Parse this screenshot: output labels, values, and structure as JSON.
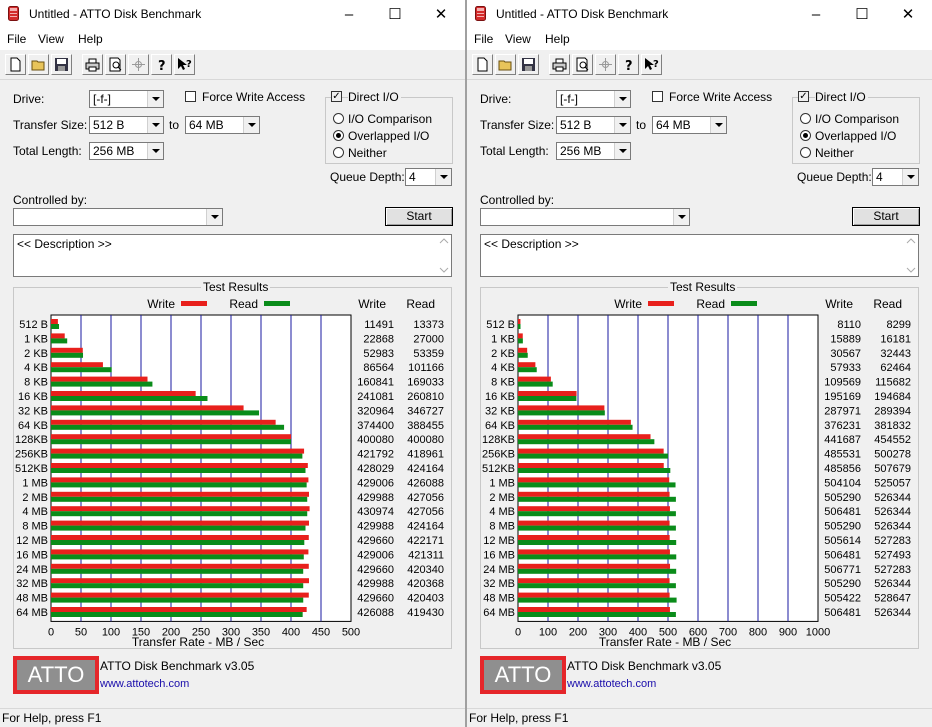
{
  "windows": [
    {
      "id": "left",
      "title": "Untitled - ATTO Disk Benchmark",
      "menu": [
        "File",
        "View",
        "Help"
      ],
      "drive_label": "Drive:",
      "drive_value": "[-f-]",
      "force_write_label": "Force Write Access",
      "force_write_checked": false,
      "direct_io_label": "Direct I/O",
      "direct_io_checked": true,
      "transfer_size_label": "Transfer Size:",
      "transfer_from": "512 B",
      "to_label": "to",
      "transfer_to": "64 MB",
      "total_length_label": "Total Length:",
      "total_length": "256 MB",
      "radio_io_comparison": "I/O Comparison",
      "radio_overlapped": "Overlapped I/O",
      "radio_neither": "Neither",
      "selected_mode": "Overlapped I/O",
      "queue_depth_label": "Queue Depth:",
      "queue_depth": "4",
      "controlled_by_label": "Controlled by:",
      "controlled_by_value": "",
      "start_label": "Start",
      "description": "<< Description >>",
      "results_title": "Test Results",
      "legend_write": "Write",
      "legend_read": "Read",
      "col_write": "Write",
      "col_read": "Read",
      "x_axis_label": "Transfer Rate - MB / Sec",
      "product": "ATTO Disk Benchmark v3.05",
      "url": "www.attotech.com",
      "logo_text": "ATTO",
      "status": "For Help, press F1"
    },
    {
      "id": "right",
      "title": "Untitled - ATTO Disk Benchmark",
      "menu": [
        "File",
        "View",
        "Help"
      ],
      "drive_label": "Drive:",
      "drive_value": "[-f-]",
      "force_write_label": "Force Write Access",
      "force_write_checked": false,
      "direct_io_label": "Direct I/O",
      "direct_io_checked": true,
      "transfer_size_label": "Transfer Size:",
      "transfer_from": "512 B",
      "to_label": "to",
      "transfer_to": "64 MB",
      "total_length_label": "Total Length:",
      "total_length": "256 MB",
      "radio_io_comparison": "I/O Comparison",
      "radio_overlapped": "Overlapped I/O",
      "radio_neither": "Neither",
      "selected_mode": "Overlapped I/O",
      "queue_depth_label": "Queue Depth:",
      "queue_depth": "4",
      "controlled_by_label": "Controlled by:",
      "controlled_by_value": "",
      "start_label": "Start",
      "description": "<< Description >>",
      "results_title": "Test Results",
      "legend_write": "Write",
      "legend_read": "Read",
      "col_write": "Write",
      "col_read": "Read",
      "x_axis_label": "Transfer Rate - MB / Sec",
      "product": "ATTO Disk Benchmark v3.05",
      "url": "www.attotech.com",
      "logo_text": "ATTO",
      "status": "For Help, press F1"
    }
  ],
  "chart_data": [
    {
      "type": "bar",
      "orientation": "horizontal",
      "categories": [
        "512 B",
        "1 KB",
        "2 KB",
        "4 KB",
        "8 KB",
        "16 KB",
        "32 KB",
        "64 KB",
        "128KB",
        "256KB",
        "512KB",
        "1 MB",
        "2 MB",
        "4 MB",
        "8 MB",
        "12 MB",
        "16 MB",
        "24 MB",
        "32 MB",
        "48 MB",
        "64 MB"
      ],
      "series": [
        {
          "name": "Write",
          "color": "#e8201c",
          "values": [
            11491,
            22868,
            52983,
            86564,
            160841,
            241081,
            320964,
            374400,
            400080,
            421792,
            428029,
            429006,
            429988,
            430974,
            429988,
            429660,
            429006,
            429660,
            429988,
            429660,
            426088
          ]
        },
        {
          "name": "Read",
          "color": "#0a8c1a",
          "values": [
            13373,
            27000,
            53359,
            101166,
            169033,
            260810,
            346727,
            388455,
            400080,
            418961,
            424164,
            426088,
            427056,
            427056,
            424164,
            422171,
            421311,
            420340,
            420368,
            420403,
            419430
          ]
        }
      ],
      "xlabel": "Transfer Rate - MB / Sec",
      "xticks": [
        0,
        50,
        100,
        150,
        200,
        250,
        300,
        350,
        400,
        450,
        500
      ],
      "xlim": [
        0,
        500
      ],
      "legend": "top"
    },
    {
      "type": "bar",
      "orientation": "horizontal",
      "categories": [
        "512 B",
        "1 KB",
        "2 KB",
        "4 KB",
        "8 KB",
        "16 KB",
        "32 KB",
        "64 KB",
        "128KB",
        "256KB",
        "512KB",
        "1 MB",
        "2 MB",
        "4 MB",
        "8 MB",
        "12 MB",
        "16 MB",
        "24 MB",
        "32 MB",
        "48 MB",
        "64 MB"
      ],
      "series": [
        {
          "name": "Write",
          "color": "#e8201c",
          "values": [
            8110,
            15889,
            30567,
            57933,
            109569,
            195169,
            287971,
            376231,
            441687,
            485531,
            485856,
            504104,
            505290,
            506481,
            505290,
            505614,
            506481,
            506771,
            505290,
            505422,
            506481
          ]
        },
        {
          "name": "Read",
          "color": "#0a8c1a",
          "values": [
            8299,
            16181,
            32443,
            62464,
            115682,
            194684,
            289394,
            381832,
            454552,
            500278,
            507679,
            525057,
            526344,
            526344,
            526344,
            527283,
            527493,
            527283,
            526344,
            528647,
            526344
          ]
        }
      ],
      "xlabel": "Transfer Rate - MB / Sec",
      "xticks": [
        0,
        100,
        200,
        300,
        400,
        500,
        600,
        700,
        800,
        900,
        1000
      ],
      "xlim": [
        0,
        1000
      ],
      "legend": "top"
    }
  ]
}
